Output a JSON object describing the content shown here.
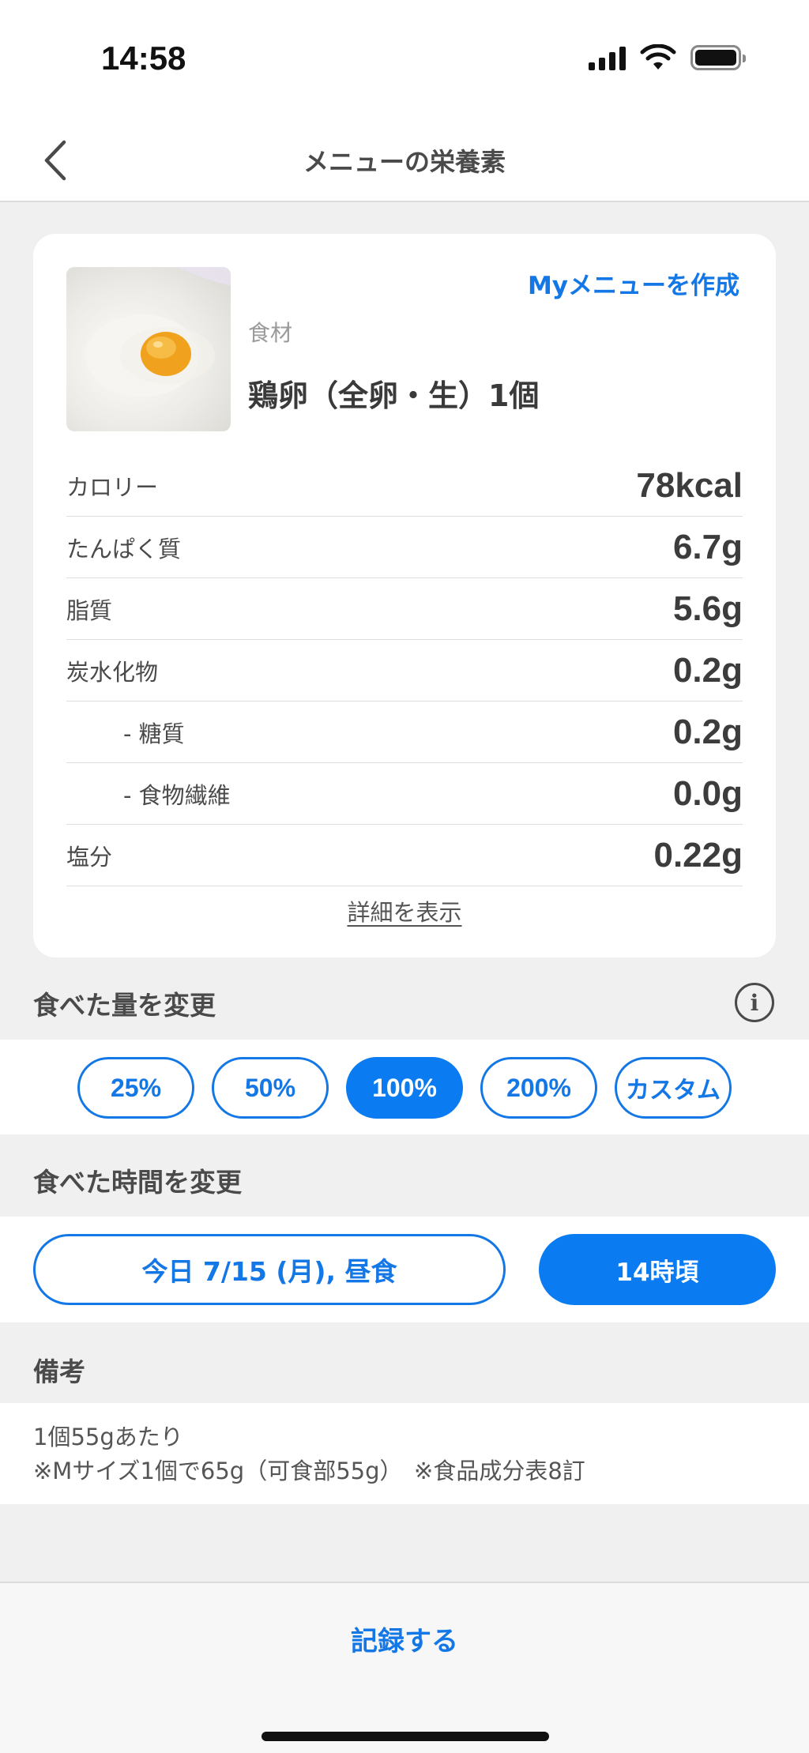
{
  "status_bar": {
    "time": "14:58",
    "icons": [
      "signal-icon",
      "wifi-icon",
      "battery-icon"
    ]
  },
  "nav": {
    "title": "メニューの栄養素",
    "back_icon": "chevron-left-icon"
  },
  "food": {
    "create_my_menu": "Myメニューを作成",
    "category": "食材",
    "name": "鶏卵（全卵・生）1個",
    "photo": "raw-egg-photo"
  },
  "nutrients": [
    {
      "label": "カロリー",
      "value": "78kcal"
    },
    {
      "label": "たんぱく質",
      "value": "6.7g"
    },
    {
      "label": "脂質",
      "value": "5.6g"
    },
    {
      "label": "炭水化物",
      "value": "0.2g"
    },
    {
      "label": "- 糖質",
      "value": "0.2g"
    },
    {
      "label": "- 食物繊維",
      "value": "0.0g"
    },
    {
      "label": "塩分",
      "value": "0.22g"
    }
  ],
  "details_link": "詳細を表示",
  "amount": {
    "header": "食べた量を変更",
    "options": [
      "25%",
      "50%",
      "100%",
      "200%",
      "カスタム"
    ],
    "selected": "100%"
  },
  "eaten_time": {
    "header": "食べた時間を変更",
    "date_meal": "今日 7/15 (月), 昼食",
    "time": "14時頃"
  },
  "notes": {
    "header": "備考",
    "line1": "1個55gあたり",
    "line2": "※Mサイズ1個で65g（可食部55g）　※食品成分表8訂"
  },
  "record_button": "記録する",
  "colors": {
    "accent": "#0a7bf0",
    "background": "#f0f0f0"
  }
}
